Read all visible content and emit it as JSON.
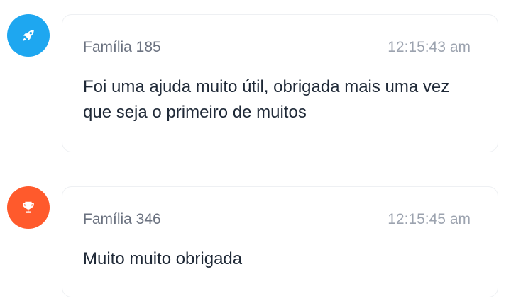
{
  "messages": [
    {
      "sender": "Família 185",
      "time": "12:15:43 am",
      "text": "Foi uma ajuda muito útil, obrigada mais uma vez que seja o primeiro de muitos",
      "avatar_icon": "rocket-icon",
      "avatar_color": "#1ea7f0"
    },
    {
      "sender": "Família 346",
      "time": "12:15:45 am",
      "text": "Muito muito obrigada",
      "avatar_icon": "trophy-icon",
      "avatar_color": "#ff5a2c"
    }
  ]
}
